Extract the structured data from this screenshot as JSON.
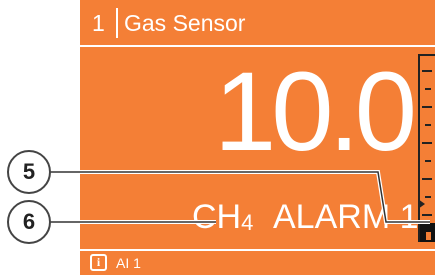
{
  "header": {
    "channel_number": "1",
    "title": "Gas Sensor"
  },
  "reading": {
    "value": "10.0"
  },
  "gas": {
    "formula_base": "CH",
    "formula_sub": "4"
  },
  "alarm": {
    "label": "ALARM 1"
  },
  "footer": {
    "icon": "info-icon",
    "text": "AI 1"
  },
  "callouts": [
    {
      "label": "5"
    },
    {
      "label": "6"
    }
  ],
  "bar_graph": {
    "level_fraction": 0.05,
    "alarm_marker_fraction": 0.2
  },
  "colors": {
    "screen_background": "#f47f36",
    "foreground": "#ffffff",
    "bar": "#222222"
  }
}
